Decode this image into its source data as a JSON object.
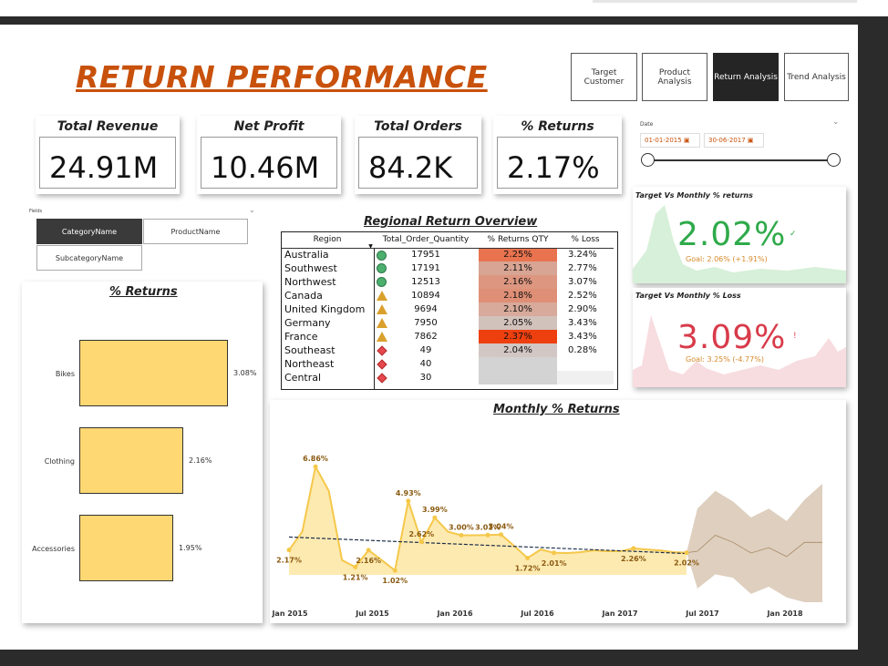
{
  "header": {
    "title": "RETURN PERFORMANCE"
  },
  "nav": {
    "items": [
      {
        "label": "Target Customer",
        "active": false
      },
      {
        "label": "Product Analysis",
        "active": false
      },
      {
        "label": "Return Analysis",
        "active": true
      },
      {
        "label": "Trend Analysis",
        "active": false
      }
    ]
  },
  "kpis": [
    {
      "label": "Total Revenue",
      "value": "24.91M"
    },
    {
      "label": "Net Profit",
      "value": "10.46M"
    },
    {
      "label": "Total Orders",
      "value": "84.2K"
    },
    {
      "label": "% Returns",
      "value": "2.17%"
    }
  ],
  "date_slicer": {
    "label": "Date",
    "start": "01-01-2015",
    "end": "30-06-2017",
    "calendar_icon": "calendar-icon"
  },
  "fields": {
    "label": "Fields",
    "options": [
      "CategoryName",
      "ProductName",
      "SubcategoryName"
    ],
    "selected": "CategoryName"
  },
  "returns_by_category": {
    "title": "% Returns",
    "categories": [
      "Bikes",
      "Clothing",
      "Accessories"
    ],
    "values": [
      3.08,
      2.16,
      1.95
    ],
    "labels": [
      "3.08%",
      "2.16%",
      "1.95%"
    ]
  },
  "regional": {
    "title": "Regional Return Overview",
    "columns": [
      "Region",
      "Total_Order_Quantity",
      "% Returns QTY",
      "% Loss"
    ],
    "rows": [
      {
        "region": "Australia",
        "status": "green",
        "qty": "17951",
        "returns": "2.25%",
        "loss": "3.24%",
        "heat": "#e9734f"
      },
      {
        "region": "Southwest",
        "status": "green",
        "qty": "17191",
        "returns": "2.11%",
        "loss": "2.77%",
        "heat": "#d8a493"
      },
      {
        "region": "Northwest",
        "status": "green",
        "qty": "12513",
        "returns": "2.16%",
        "loss": "3.07%",
        "heat": "#dd9680"
      },
      {
        "region": "Canada",
        "status": "amber",
        "qty": "10894",
        "returns": "2.18%",
        "loss": "2.52%",
        "heat": "#df8f76"
      },
      {
        "region": "United Kingdom",
        "status": "amber",
        "qty": "9694",
        "returns": "2.10%",
        "loss": "2.90%",
        "heat": "#d8aa9b"
      },
      {
        "region": "Germany",
        "status": "amber",
        "qty": "7950",
        "returns": "2.05%",
        "loss": "3.43%",
        "heat": "#d2c2bc"
      },
      {
        "region": "France",
        "status": "amber",
        "qty": "7862",
        "returns": "2.37%",
        "loss": "3.43%",
        "heat": "#ee3f0f"
      },
      {
        "region": "Southeast",
        "status": "red",
        "qty": "49",
        "returns": "2.04%",
        "loss": "0.28%",
        "heat": "#d2c7c4"
      },
      {
        "region": "Northeast",
        "status": "red",
        "qty": "40",
        "returns": "",
        "loss": "",
        "heat": "#d3d3d3"
      },
      {
        "region": "Central",
        "status": "red",
        "qty": "30",
        "returns": "",
        "loss": "",
        "heat": "#d3d3d3"
      }
    ],
    "status_colors": {
      "green": "#4caf6e",
      "amber": "#d9a02c",
      "red": "#e5484d"
    }
  },
  "target_returns": {
    "title": "Target Vs Monthly % returns",
    "value": "2.02%",
    "goal": "Goal: 2.06% (+1.91%)",
    "color": "#2eaa4a",
    "indicator": "✓"
  },
  "target_loss": {
    "title": "Target Vs Monthly % Loss",
    "value": "3.09%",
    "goal": "Goal: 3.25% (-4.77%)",
    "color": "#d83b4a",
    "indicator": "!"
  },
  "monthly": {
    "title": "Monthly % Returns",
    "x_ticks": [
      "Jan 2015",
      "Jul 2015",
      "Jan 2016",
      "Jul 2016",
      "Jan 2017",
      "Jul 2017",
      "Jan 2018"
    ]
  },
  "chart_data": [
    {
      "type": "bar",
      "title": "% Returns",
      "orientation": "horizontal",
      "categories": [
        "Bikes",
        "Clothing",
        "Accessories"
      ],
      "values": [
        3.08,
        2.16,
        1.95
      ],
      "value_unit": "%"
    },
    {
      "type": "area",
      "title": "Monthly % Returns",
      "x_ticks": [
        "Jan 2015",
        "Jul 2015",
        "Jan 2016",
        "Jul 2016",
        "Jan 2017",
        "Jul 2017",
        "Jan 2018"
      ],
      "series": [
        {
          "values": [
            2.17,
            3.2,
            6.86,
            5.5,
            1.6,
            1.21,
            2.16,
            1.6,
            1.02,
            4.93,
            2.62,
            3.99,
            3.2,
            3.0,
            3.0,
            3.01,
            3.04,
            2.4,
            1.72,
            2.2,
            2.01,
            2.0,
            2.05,
            2.15,
            2.1,
            2.1,
            2.26,
            2.2,
            2.15,
            2.05,
            2.02
          ]
        }
      ],
      "labels": [
        {
          "index": 0,
          "text": "2.17%"
        },
        {
          "index": 2,
          "text": "6.86%"
        },
        {
          "index": 5,
          "text": "1.21%"
        },
        {
          "index": 6,
          "text": "2.16%"
        },
        {
          "index": 8,
          "text": "1.02%"
        },
        {
          "index": 9,
          "text": "4.93%"
        },
        {
          "index": 10,
          "text": "2.62%"
        },
        {
          "index": 11,
          "text": "3.99%"
        },
        {
          "index": 13,
          "text": "3.00%"
        },
        {
          "index": 15,
          "text": "3.01%"
        },
        {
          "index": 16,
          "text": "3.04%"
        },
        {
          "index": 18,
          "text": "1.72%"
        },
        {
          "index": 20,
          "text": "2.01%"
        },
        {
          "index": 26,
          "text": "2.26%"
        },
        {
          "index": 30,
          "text": "2.02%"
        }
      ],
      "trendline": true,
      "forecast": {
        "months": 8,
        "upper": [
          4.5,
          5.5,
          4.9,
          4.0,
          4.5,
          3.8,
          5.0,
          5.9
        ],
        "mid": [
          2.1,
          3.0,
          2.6,
          2.0,
          2.3,
          1.8,
          2.6,
          2.6
        ],
        "lower": [
          0.0,
          0.8,
          0.6,
          -0.3,
          0.1,
          -0.5,
          -1.0,
          -1.3
        ]
      }
    }
  ]
}
